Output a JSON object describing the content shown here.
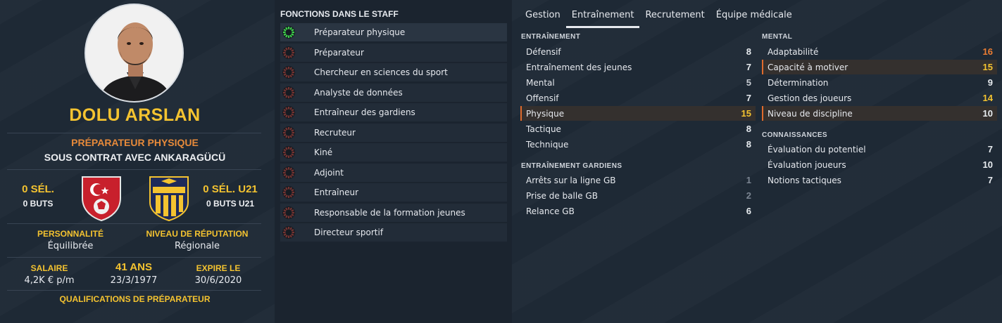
{
  "profile": {
    "name": "DOLU ARSLAN",
    "role": "PRÉPARATEUR PHYSIQUE",
    "contract": "SOUS CONTRAT AVEC ANKARAGÜCÜ",
    "caps_label": "0 SÉL.",
    "goals_label": "0 BUTS",
    "caps_u21_label": "0 SÉL. U21",
    "goals_u21_label": "0 BUTS U21",
    "personality_label": "PERSONNALITÉ",
    "personality_value": "Équilibrée",
    "reputation_label": "NIVEAU DE RÉPUTATION",
    "reputation_value": "Régionale",
    "salary_label": "SALAIRE",
    "salary_value": "4,2K € p/m",
    "age_label": "41 ANS",
    "birthdate": "23/3/1977",
    "expires_label": "EXPIRE LE",
    "expires_value": "30/6/2020",
    "qualifications_label": "QUALIFICATIONS DE PRÉPARATEUR"
  },
  "functions": {
    "title": "FONCTIONS DANS LE STAFF",
    "items": [
      {
        "label": "Préparateur physique",
        "active": true
      },
      {
        "label": "Préparateur",
        "active": false
      },
      {
        "label": "Chercheur en sciences du sport",
        "active": false
      },
      {
        "label": "Analyste de données",
        "active": false
      },
      {
        "label": "Entraîneur des gardiens",
        "active": false
      },
      {
        "label": "Recruteur",
        "active": false
      },
      {
        "label": "Kiné",
        "active": false
      },
      {
        "label": "Adjoint",
        "active": false
      },
      {
        "label": "Entraîneur",
        "active": false
      },
      {
        "label": "Responsable de la formation jeunes",
        "active": false
      },
      {
        "label": "Directeur sportif",
        "active": false
      }
    ]
  },
  "tabs": [
    "Gestion",
    "Entraînement",
    "Recrutement",
    "Équipe médicale"
  ],
  "active_tab": "Entraînement",
  "sections": {
    "training": {
      "title": "ENTRAÎNEMENT",
      "items": [
        {
          "name": "Défensif",
          "value": "8"
        },
        {
          "name": "Entraînement des jeunes",
          "value": "7"
        },
        {
          "name": "Mental",
          "value": "5"
        },
        {
          "name": "Offensif",
          "value": "7"
        },
        {
          "name": "Physique",
          "value": "15"
        },
        {
          "name": "Tactique",
          "value": "8"
        },
        {
          "name": "Technique",
          "value": "8"
        }
      ]
    },
    "gk_training": {
      "title": "ENTRAÎNEMENT GARDIENS",
      "items": [
        {
          "name": "Arrêts sur la ligne GB",
          "value": "1"
        },
        {
          "name": "Prise de balle GB",
          "value": "2"
        },
        {
          "name": "Relance GB",
          "value": "6"
        }
      ]
    },
    "mental": {
      "title": "MENTAL",
      "items": [
        {
          "name": "Adaptabilité",
          "value": "16"
        },
        {
          "name": "Capacité à motiver",
          "value": "15"
        },
        {
          "name": "Détermination",
          "value": "9"
        },
        {
          "name": "Gestion des joueurs",
          "value": "14"
        },
        {
          "name": "Niveau de discipline",
          "value": "10"
        }
      ]
    },
    "knowledge": {
      "title": "CONNAISSANCES",
      "items": [
        {
          "name": "Évaluation du potentiel",
          "value": "7"
        },
        {
          "name": "Évaluation joueurs",
          "value": "10"
        },
        {
          "name": "Notions tactiques",
          "value": "7"
        }
      ]
    }
  },
  "colors": {
    "accent_yellow": "#f4c330",
    "accent_orange": "#ec7d32",
    "role_orange": "#e78a3a",
    "highlight_border": "#e06b2c",
    "active_green": "#3ed14a"
  }
}
